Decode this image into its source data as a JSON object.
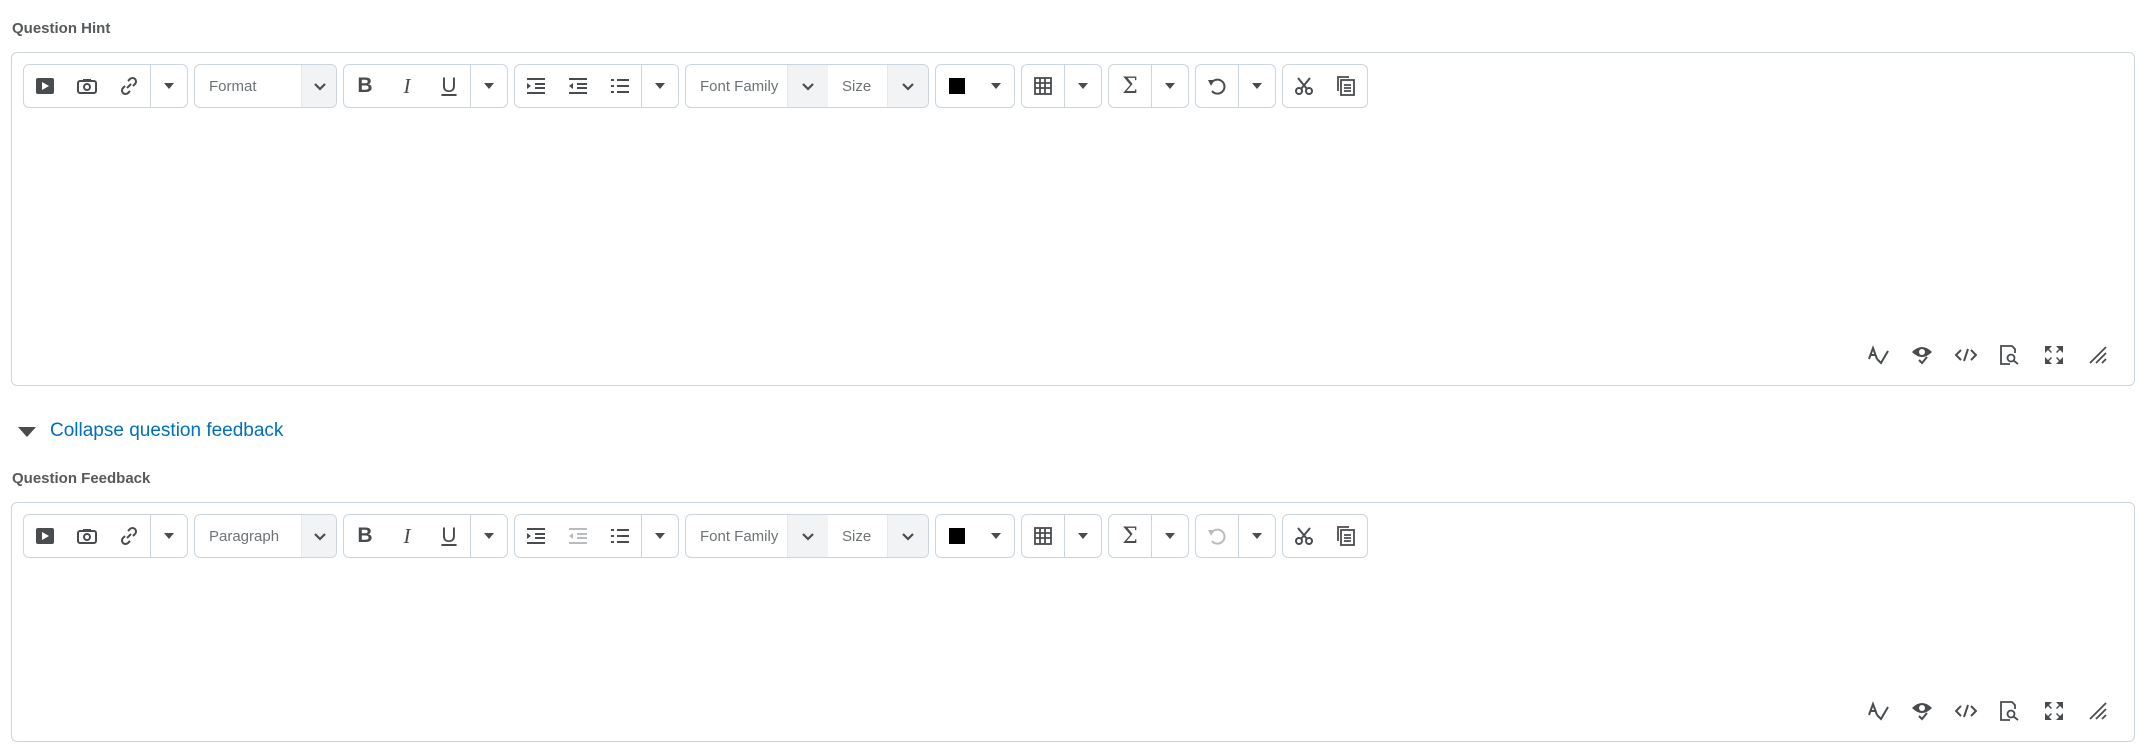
{
  "hint": {
    "label": "Question Hint",
    "format_label": "Format",
    "undo_disabled": false,
    "outdent_disabled": false
  },
  "collapse": {
    "label": "Collapse question feedback"
  },
  "feedback": {
    "label": "Question Feedback",
    "format_label": "Paragraph",
    "undo_disabled": true,
    "outdent_disabled": true
  },
  "toolbar": {
    "bold": "B",
    "italic": "I",
    "underline": "U",
    "font_family": "Font Family",
    "size": "Size",
    "sigma": "Σ"
  },
  "colors": {
    "text_color": "#000000",
    "accent_link": "#006fbf"
  },
  "icons": {
    "insert": [
      "video-icon",
      "image-icon",
      "link-icon"
    ],
    "bottom": [
      "spellcheck-icon",
      "accessibility-check-icon",
      "source-code-icon",
      "preview-icon",
      "fullscreen-icon",
      "resize-handle-icon"
    ]
  }
}
